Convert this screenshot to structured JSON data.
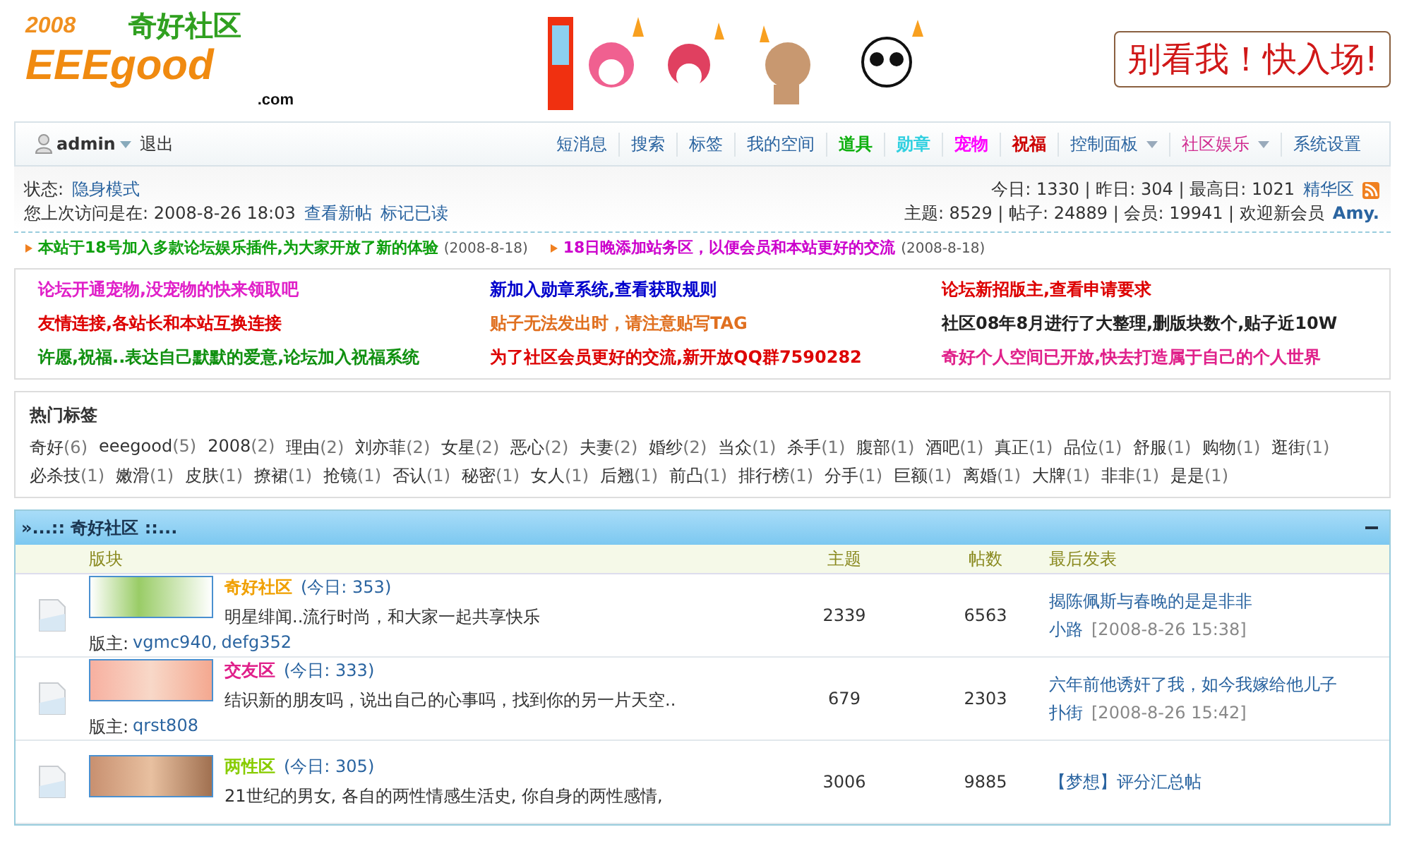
{
  "header": {
    "logo": {
      "year": "2008",
      "name": "奇好社区",
      "brand": "EEEgood",
      "domain": ".com"
    },
    "banner": "别看我！快入场!"
  },
  "nav": {
    "user": "admin",
    "logout": "退出",
    "links": [
      {
        "label": "短消息",
        "color": "#2a64a0",
        "bold": false,
        "dropdown": false
      },
      {
        "label": "搜索",
        "color": "#2a64a0",
        "bold": false,
        "dropdown": false
      },
      {
        "label": "标签",
        "color": "#2a64a0",
        "bold": false,
        "dropdown": false
      },
      {
        "label": "我的空间",
        "color": "#2a64a0",
        "bold": false,
        "dropdown": false
      },
      {
        "label": "道具",
        "color": "#10b010",
        "bold": true,
        "dropdown": false
      },
      {
        "label": "勋章",
        "color": "#30d0e0",
        "bold": true,
        "dropdown": false
      },
      {
        "label": "宠物",
        "color": "#ff00ff",
        "bold": true,
        "dropdown": false
      },
      {
        "label": "祝福",
        "color": "#cc0000",
        "bold": true,
        "dropdown": false
      },
      {
        "label": "控制面板",
        "color": "#2a64a0",
        "bold": false,
        "dropdown": true
      },
      {
        "label": "社区娱乐",
        "color": "#d02c90",
        "bold": false,
        "dropdown": true
      },
      {
        "label": "系统设置",
        "color": "#2a64a0",
        "bold": false,
        "dropdown": false
      }
    ]
  },
  "status": {
    "label": "状态:",
    "mode": "隐身模式",
    "last_visit": "您上次访问是在: 2008-8-26 18:03",
    "links": [
      "查看新帖",
      "标记已读"
    ],
    "today_stats": "今日: 1330 | 昨日: 304 | 最高日: 1021",
    "digest": "精华区",
    "totals": "主题: 8529 | 帖子: 24889 | 会员: 19941 | 欢迎新会员",
    "new_member": "Amy."
  },
  "marquee": [
    {
      "text": "本站于18号加入多款论坛娱乐插件,为大家开放了新的体验",
      "date": "(2008-8-18)",
      "color": "#10a010"
    },
    {
      "text": "18日晚添加站务区，以便会员和本站更好的交流",
      "date": "(2008-8-18)",
      "color": "#cc00cc"
    }
  ],
  "announcements": [
    {
      "text": "论坛开通宠物,没宠物的快来领取吧",
      "color": "#e020c8"
    },
    {
      "text": "新加入勋章系统,查看获取规则",
      "color": "#0000cc"
    },
    {
      "text": "论坛新招版主,查看申请要求",
      "color": "#dd0000"
    },
    {
      "text": "友情连接,各站长和本站互换连接",
      "color": "#dd0000"
    },
    {
      "text": "贴子无法发出时，请注意贴写TAG",
      "color": "#e07020"
    },
    {
      "text": "社区08年8月进行了大整理,删版块数个,贴子近10W",
      "color": "#222222"
    },
    {
      "text": "许愿,祝福..表达自己默默的爱意,论坛加入祝福系统",
      "color": "#109010"
    },
    {
      "text": "为了社区会员更好的交流,新开放QQ群7590282",
      "color": "#dd0000"
    },
    {
      "text": "奇好个人空间已开放,快去打造属于自己的个人世界",
      "color": "#e0208a"
    }
  ],
  "tags": {
    "title": "热门标签",
    "items": [
      {
        "name": "奇好",
        "count": "(6)"
      },
      {
        "name": "eeegood",
        "count": "(5)"
      },
      {
        "name": "2008",
        "count": "(2)"
      },
      {
        "name": "理由",
        "count": "(2)"
      },
      {
        "name": "刘亦菲",
        "count": "(2)"
      },
      {
        "name": "女星",
        "count": "(2)"
      },
      {
        "name": "恶心",
        "count": "(2)"
      },
      {
        "name": "夫妻",
        "count": "(2)"
      },
      {
        "name": "婚纱",
        "count": "(2)"
      },
      {
        "name": "当众",
        "count": "(1)"
      },
      {
        "name": "杀手",
        "count": "(1)"
      },
      {
        "name": "腹部",
        "count": "(1)"
      },
      {
        "name": "酒吧",
        "count": "(1)"
      },
      {
        "name": "真正",
        "count": "(1)"
      },
      {
        "name": "品位",
        "count": "(1)"
      },
      {
        "name": "舒服",
        "count": "(1)"
      },
      {
        "name": "购物",
        "count": "(1)"
      },
      {
        "name": "逛街",
        "count": "(1)"
      },
      {
        "name": "必杀技",
        "count": "(1)"
      },
      {
        "name": "嫩滑",
        "count": "(1)"
      },
      {
        "name": "皮肤",
        "count": "(1)"
      },
      {
        "name": "撩裙",
        "count": "(1)"
      },
      {
        "name": "抢镜",
        "count": "(1)"
      },
      {
        "name": "否认",
        "count": "(1)"
      },
      {
        "name": "秘密",
        "count": "(1)"
      },
      {
        "name": "女人",
        "count": "(1)"
      },
      {
        "name": "后翘",
        "count": "(1)"
      },
      {
        "name": "前凸",
        "count": "(1)"
      },
      {
        "name": "排行榜",
        "count": "(1)"
      },
      {
        "name": "分手",
        "count": "(1)"
      },
      {
        "name": "巨额",
        "count": "(1)"
      },
      {
        "name": "离婚",
        "count": "(1)"
      },
      {
        "name": "大牌",
        "count": "(1)"
      },
      {
        "name": "非非",
        "count": "(1)"
      },
      {
        "name": "是是",
        "count": "(1)"
      }
    ]
  },
  "forum": {
    "title": "»...:: 奇好社区 ::...",
    "columns": [
      "版块",
      "主题",
      "帖数",
      "最后发表"
    ],
    "rows": [
      {
        "name": "奇好社区",
        "color": "#f0a000",
        "today": "(今日: 353)",
        "description": "明星绯闻..流行时尚，和大家一起共享快乐",
        "moderator_label": "版主:",
        "moderator_separator": ",",
        "moderators": [
          "vgmc940",
          "defg352"
        ],
        "topics": "2339",
        "posts": "6563",
        "last_title": "揭陈佩斯与春晚的是是非非",
        "last_author": "小路",
        "last_time": "[2008-8-26 15:38]"
      },
      {
        "name": "交友区",
        "color": "#e0208a",
        "today": "(今日: 333)",
        "description": "结识新的朋友吗，说出自己的心事吗，找到你的另一片天空..",
        "moderator_label": "版主:",
        "moderators": [
          "qrst808"
        ],
        "topics": "679",
        "posts": "2303",
        "last_title": "六年前他诱奸了我，如今我嫁给他儿子",
        "last_author": "扑街",
        "last_time": "[2008-8-26 15:42]"
      },
      {
        "name": "两性区",
        "color": "#88cc00",
        "today": "(今日: 305)",
        "description": "21世纪的男女, 各自的两性情感生活史, 你自身的两性感情,",
        "moderator_label": "",
        "moderators": [],
        "topics": "3006",
        "posts": "9885",
        "last_title": "【梦想】评分汇总帖",
        "last_author": "",
        "last_time": ""
      }
    ]
  }
}
